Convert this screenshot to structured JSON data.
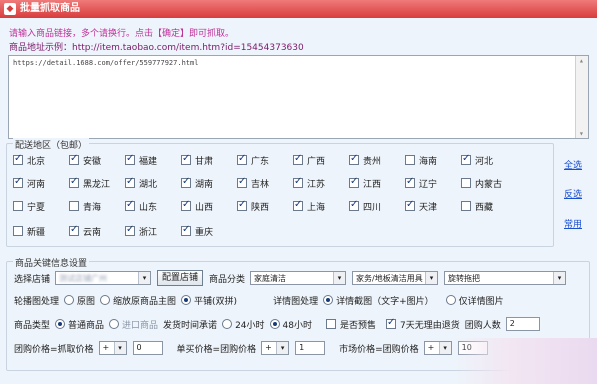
{
  "window": {
    "title": "批量抓取商品"
  },
  "hint": "请输入商品链接，多个请换行。点击【确定】即可抓取。",
  "example": "商品地址示例：http://item.taobao.com/item.htm?id=15454373630",
  "url_input": {
    "value": "https://detail.1688.com/offer/559777927.html"
  },
  "regions_group": {
    "title": "配送地区（包邮）",
    "rows": [
      [
        {
          "name": "北京",
          "checked": true
        },
        {
          "name": "安徽",
          "checked": true
        },
        {
          "name": "福建",
          "checked": true
        },
        {
          "name": "甘肃",
          "checked": true
        },
        {
          "name": "广东",
          "checked": true
        },
        {
          "name": "广西",
          "checked": true
        },
        {
          "name": "贵州",
          "checked": true
        },
        {
          "name": "海南",
          "checked": false
        },
        {
          "name": "河北",
          "checked": true
        }
      ],
      [
        {
          "name": "河南",
          "checked": true
        },
        {
          "name": "黑龙江",
          "checked": true
        },
        {
          "name": "湖北",
          "checked": true
        },
        {
          "name": "湖南",
          "checked": true
        },
        {
          "name": "吉林",
          "checked": true
        },
        {
          "name": "江苏",
          "checked": true
        },
        {
          "name": "江西",
          "checked": true
        },
        {
          "name": "辽宁",
          "checked": true
        },
        {
          "name": "内蒙古",
          "checked": false
        }
      ],
      [
        {
          "name": "宁夏",
          "checked": false
        },
        {
          "name": "青海",
          "checked": false
        },
        {
          "name": "山东",
          "checked": true
        },
        {
          "name": "山西",
          "checked": true
        },
        {
          "name": "陕西",
          "checked": true
        },
        {
          "name": "上海",
          "checked": true
        },
        {
          "name": "四川",
          "checked": true
        },
        {
          "name": "天津",
          "checked": true
        },
        {
          "name": "西藏",
          "checked": false
        }
      ],
      [
        {
          "name": "新疆",
          "checked": false
        },
        {
          "name": "云南",
          "checked": true
        },
        {
          "name": "浙江",
          "checked": true
        },
        {
          "name": "重庆",
          "checked": true
        }
      ]
    ],
    "links": {
      "select_all": "全选",
      "invert": "反选",
      "common": "常用"
    }
  },
  "settings_group": {
    "title": "商品关键信息设置",
    "shop_label": "选择店铺",
    "shop_value": "测试店铺广州",
    "shop_button": "配置店铺",
    "category_label": "商品分类",
    "category_value": "家庭清洁",
    "category2_value": "家务/地板清洁用具",
    "category3_value": "旋转拖把",
    "main_image_label": "轮播图处理",
    "main_image_options": [
      "原图",
      "缩放原商品主图",
      "平铺(双拼)"
    ],
    "main_image_selected": 2,
    "detail_image_label": "详情图处理",
    "detail_image_options": [
      "详情截图（文字+图片）",
      "仅详情图片"
    ],
    "detail_image_selected": 0,
    "type_label": "商品类型",
    "type_options": [
      "普通商品",
      "进口商品"
    ],
    "type_selected": 0,
    "ship_label": "发货时间承诺",
    "ship_options": [
      "24小时",
      "48小时"
    ],
    "ship_selected": 1,
    "presale_label": "是否预售",
    "presale_checked": false,
    "return_label": "7天无理由退货",
    "return_checked": true,
    "group_people_label": "团购人数",
    "group_people_value": "2",
    "group_price_label": "团购价格=抓取价格",
    "group_price_op": "+",
    "group_price_value": "0",
    "single_price_label": "单买价格=团购价格",
    "single_price_op": "+",
    "single_price_value": "1",
    "market_price_label": "市场价格=团购价格",
    "market_price_op": "+",
    "market_price_value": "10"
  }
}
